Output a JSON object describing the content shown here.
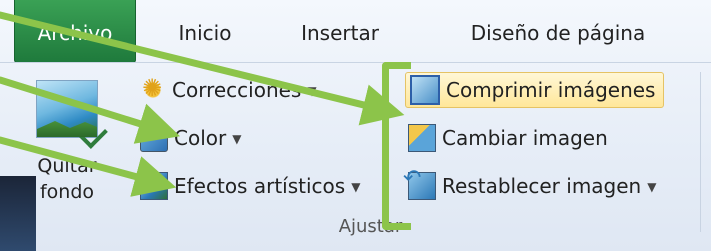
{
  "tabs": [
    {
      "label": "Archivo",
      "active": true
    },
    {
      "label": "Inicio",
      "active": false
    },
    {
      "label": "Insertar",
      "active": false
    },
    {
      "label": "Diseño de página",
      "active": false
    }
  ],
  "ribbon": {
    "remove_bg": {
      "line1": "Quitar",
      "line2": "fondo",
      "icon": "remove-background-icon"
    },
    "left_column": [
      {
        "label": "Correcciones",
        "icon": "corrections-sun-icon",
        "has_dropdown": true
      },
      {
        "label": "Color",
        "icon": "color-icon",
        "has_dropdown": true
      },
      {
        "label": "Efectos artísticos",
        "icon": "artistic-effects-icon",
        "has_dropdown": true
      }
    ],
    "right_column": [
      {
        "label": "Comprimir imágenes",
        "icon": "compress-pictures-icon",
        "has_dropdown": false,
        "highlighted": true
      },
      {
        "label": "Cambiar imagen",
        "icon": "change-picture-icon",
        "has_dropdown": false
      },
      {
        "label": "Restablecer imagen",
        "icon": "reset-picture-icon",
        "has_dropdown": true
      }
    ],
    "group_label": "Ajustar"
  },
  "colors": {
    "archivo_tab": "#2a8c47",
    "annotation": "#8cc44a",
    "highlight": "#ffe79a"
  }
}
